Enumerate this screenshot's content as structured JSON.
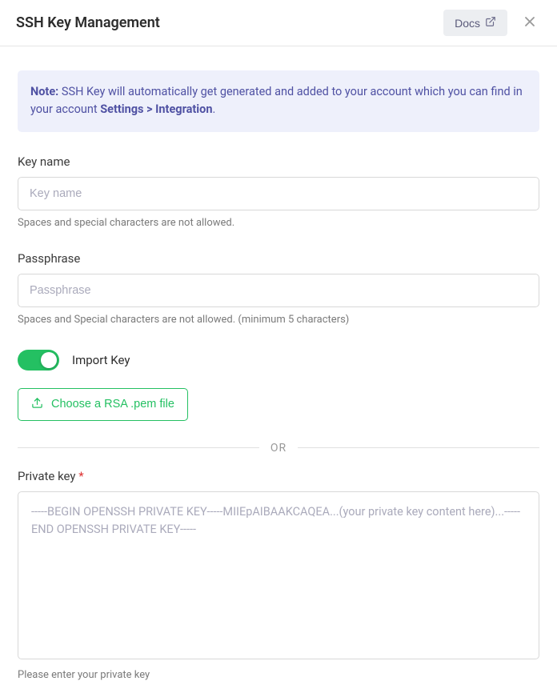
{
  "header": {
    "title": "SSH Key Management",
    "docs_label": "Docs"
  },
  "note": {
    "label": "Note:",
    "text_part1": " SSH Key will automatically get generated and added to your account which you can find in your account ",
    "settings_path": "Settings > Integration",
    "text_part2": "."
  },
  "keyname": {
    "label": "Key name",
    "placeholder": "Key name",
    "help": "Spaces and special characters are not allowed."
  },
  "passphrase": {
    "label": "Passphrase",
    "placeholder": "Passphrase",
    "help": "Spaces and Special characters are not allowed. (minimum 5 characters)"
  },
  "import": {
    "toggle_label": "Import Key",
    "choose_label": "Choose a RSA .pem file"
  },
  "divider": {
    "text": "OR"
  },
  "privatekey": {
    "label": "Private key ",
    "required": "*",
    "placeholder": "-----BEGIN OPENSSH PRIVATE KEY-----MIIEpAIBAAKCAQEA...(your private key content here)...-----END OPENSSH PRIVATE KEY-----",
    "help": "Please enter your private key"
  }
}
